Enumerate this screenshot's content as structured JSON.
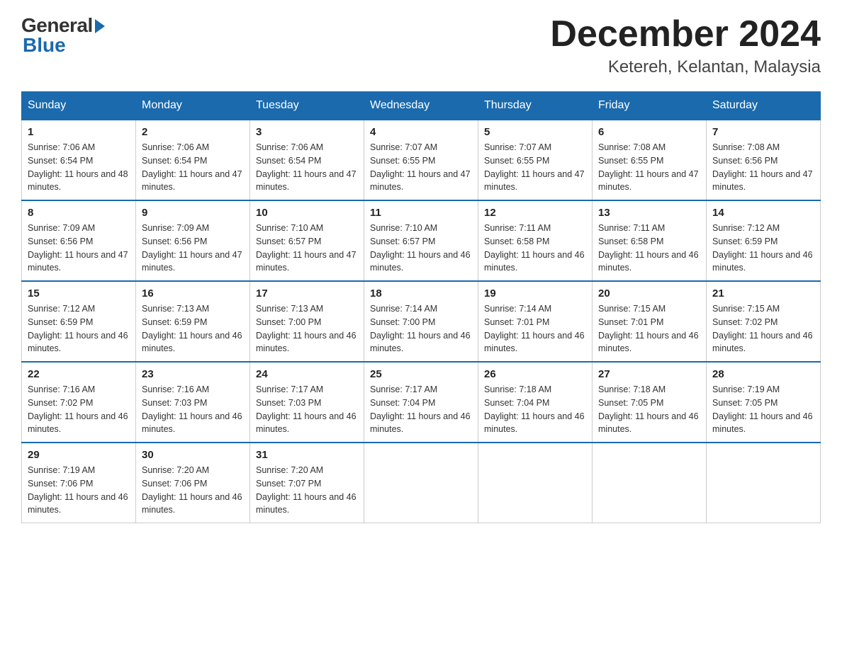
{
  "logo": {
    "general": "General",
    "blue": "Blue"
  },
  "header": {
    "month": "December 2024",
    "location": "Ketereh, Kelantan, Malaysia"
  },
  "weekdays": [
    "Sunday",
    "Monday",
    "Tuesday",
    "Wednesday",
    "Thursday",
    "Friday",
    "Saturday"
  ],
  "weeks": [
    [
      {
        "day": "1",
        "sunrise": "7:06 AM",
        "sunset": "6:54 PM",
        "daylight": "11 hours and 48 minutes."
      },
      {
        "day": "2",
        "sunrise": "7:06 AM",
        "sunset": "6:54 PM",
        "daylight": "11 hours and 47 minutes."
      },
      {
        "day": "3",
        "sunrise": "7:06 AM",
        "sunset": "6:54 PM",
        "daylight": "11 hours and 47 minutes."
      },
      {
        "day": "4",
        "sunrise": "7:07 AM",
        "sunset": "6:55 PM",
        "daylight": "11 hours and 47 minutes."
      },
      {
        "day": "5",
        "sunrise": "7:07 AM",
        "sunset": "6:55 PM",
        "daylight": "11 hours and 47 minutes."
      },
      {
        "day": "6",
        "sunrise": "7:08 AM",
        "sunset": "6:55 PM",
        "daylight": "11 hours and 47 minutes."
      },
      {
        "day": "7",
        "sunrise": "7:08 AM",
        "sunset": "6:56 PM",
        "daylight": "11 hours and 47 minutes."
      }
    ],
    [
      {
        "day": "8",
        "sunrise": "7:09 AM",
        "sunset": "6:56 PM",
        "daylight": "11 hours and 47 minutes."
      },
      {
        "day": "9",
        "sunrise": "7:09 AM",
        "sunset": "6:56 PM",
        "daylight": "11 hours and 47 minutes."
      },
      {
        "day": "10",
        "sunrise": "7:10 AM",
        "sunset": "6:57 PM",
        "daylight": "11 hours and 47 minutes."
      },
      {
        "day": "11",
        "sunrise": "7:10 AM",
        "sunset": "6:57 PM",
        "daylight": "11 hours and 46 minutes."
      },
      {
        "day": "12",
        "sunrise": "7:11 AM",
        "sunset": "6:58 PM",
        "daylight": "11 hours and 46 minutes."
      },
      {
        "day": "13",
        "sunrise": "7:11 AM",
        "sunset": "6:58 PM",
        "daylight": "11 hours and 46 minutes."
      },
      {
        "day": "14",
        "sunrise": "7:12 AM",
        "sunset": "6:59 PM",
        "daylight": "11 hours and 46 minutes."
      }
    ],
    [
      {
        "day": "15",
        "sunrise": "7:12 AM",
        "sunset": "6:59 PM",
        "daylight": "11 hours and 46 minutes."
      },
      {
        "day": "16",
        "sunrise": "7:13 AM",
        "sunset": "6:59 PM",
        "daylight": "11 hours and 46 minutes."
      },
      {
        "day": "17",
        "sunrise": "7:13 AM",
        "sunset": "7:00 PM",
        "daylight": "11 hours and 46 minutes."
      },
      {
        "day": "18",
        "sunrise": "7:14 AM",
        "sunset": "7:00 PM",
        "daylight": "11 hours and 46 minutes."
      },
      {
        "day": "19",
        "sunrise": "7:14 AM",
        "sunset": "7:01 PM",
        "daylight": "11 hours and 46 minutes."
      },
      {
        "day": "20",
        "sunrise": "7:15 AM",
        "sunset": "7:01 PM",
        "daylight": "11 hours and 46 minutes."
      },
      {
        "day": "21",
        "sunrise": "7:15 AM",
        "sunset": "7:02 PM",
        "daylight": "11 hours and 46 minutes."
      }
    ],
    [
      {
        "day": "22",
        "sunrise": "7:16 AM",
        "sunset": "7:02 PM",
        "daylight": "11 hours and 46 minutes."
      },
      {
        "day": "23",
        "sunrise": "7:16 AM",
        "sunset": "7:03 PM",
        "daylight": "11 hours and 46 minutes."
      },
      {
        "day": "24",
        "sunrise": "7:17 AM",
        "sunset": "7:03 PM",
        "daylight": "11 hours and 46 minutes."
      },
      {
        "day": "25",
        "sunrise": "7:17 AM",
        "sunset": "7:04 PM",
        "daylight": "11 hours and 46 minutes."
      },
      {
        "day": "26",
        "sunrise": "7:18 AM",
        "sunset": "7:04 PM",
        "daylight": "11 hours and 46 minutes."
      },
      {
        "day": "27",
        "sunrise": "7:18 AM",
        "sunset": "7:05 PM",
        "daylight": "11 hours and 46 minutes."
      },
      {
        "day": "28",
        "sunrise": "7:19 AM",
        "sunset": "7:05 PM",
        "daylight": "11 hours and 46 minutes."
      }
    ],
    [
      {
        "day": "29",
        "sunrise": "7:19 AM",
        "sunset": "7:06 PM",
        "daylight": "11 hours and 46 minutes."
      },
      {
        "day": "30",
        "sunrise": "7:20 AM",
        "sunset": "7:06 PM",
        "daylight": "11 hours and 46 minutes."
      },
      {
        "day": "31",
        "sunrise": "7:20 AM",
        "sunset": "7:07 PM",
        "daylight": "11 hours and 46 minutes."
      },
      null,
      null,
      null,
      null
    ]
  ],
  "labels": {
    "sunrise": "Sunrise:",
    "sunset": "Sunset:",
    "daylight": "Daylight:"
  }
}
